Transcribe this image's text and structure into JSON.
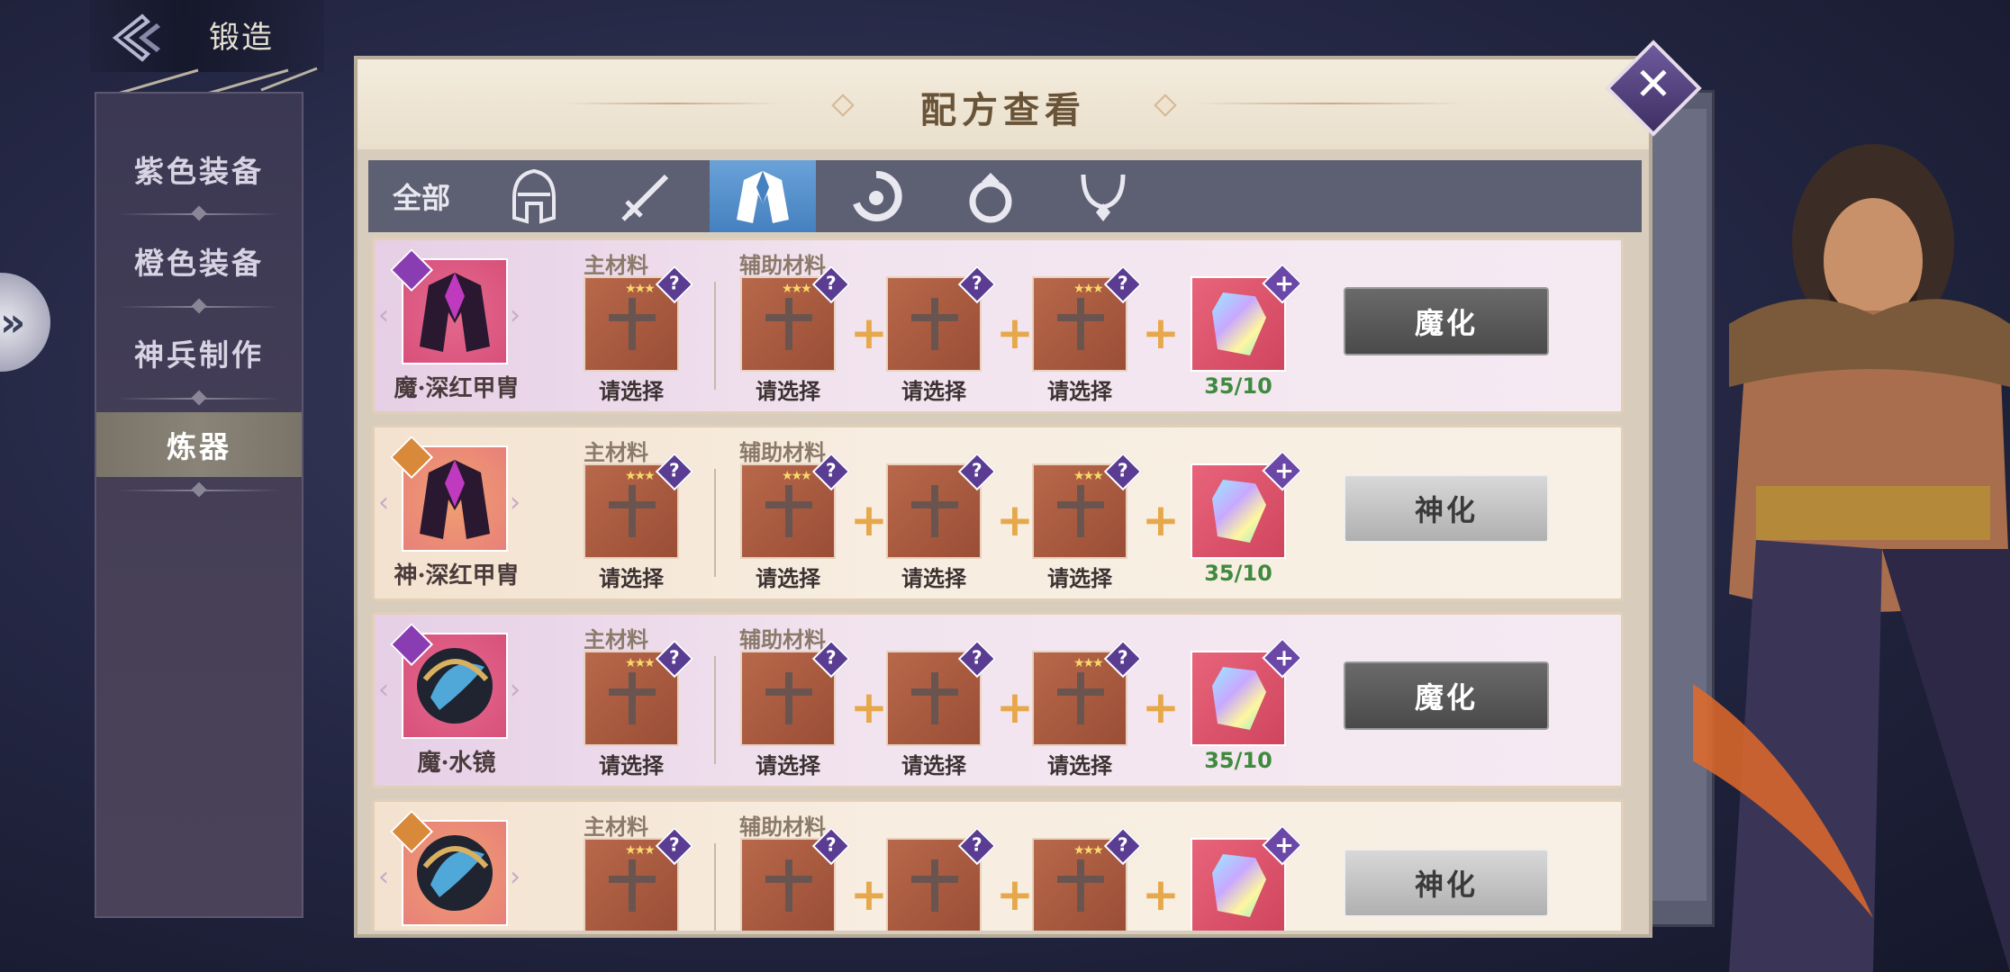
{
  "header": {
    "title": "锻造"
  },
  "sidebar": {
    "items": [
      {
        "label": "紫色装备"
      },
      {
        "label": "橙色装备"
      },
      {
        "label": "神兵制作"
      },
      {
        "label": "炼器"
      }
    ],
    "active_index": 3
  },
  "dialog": {
    "title": "配方查看",
    "tabs": [
      {
        "label": "全部",
        "icon": "all"
      },
      {
        "label": "",
        "icon": "helmet-icon"
      },
      {
        "label": "",
        "icon": "sword-icon"
      },
      {
        "label": "",
        "icon": "armor-icon"
      },
      {
        "label": "",
        "icon": "bracelet-icon"
      },
      {
        "label": "",
        "icon": "ring-icon"
      },
      {
        "label": "",
        "icon": "necklace-icon"
      }
    ],
    "active_tab": 3,
    "labels": {
      "main": "主材料",
      "aux": "辅助材料",
      "select": "请选择"
    }
  },
  "recipes": [
    {
      "name": "魔·深红甲胄",
      "tier": "purple",
      "count": "35/10",
      "action": "魔化",
      "action_style": "dark"
    },
    {
      "name": "神·深红甲胄",
      "tier": "gold",
      "count": "35/10",
      "action": "神化",
      "action_style": "light"
    },
    {
      "name": "魔·水镜",
      "tier": "purple",
      "count": "35/10",
      "action": "魔化",
      "action_style": "dark"
    },
    {
      "name": "",
      "tier": "gold",
      "count": "",
      "action": "神化",
      "action_style": "light"
    }
  ],
  "colors": {
    "accent": "#4580c0",
    "count_green": "#3f8a3f",
    "plus_orange": "#e6a84a"
  }
}
